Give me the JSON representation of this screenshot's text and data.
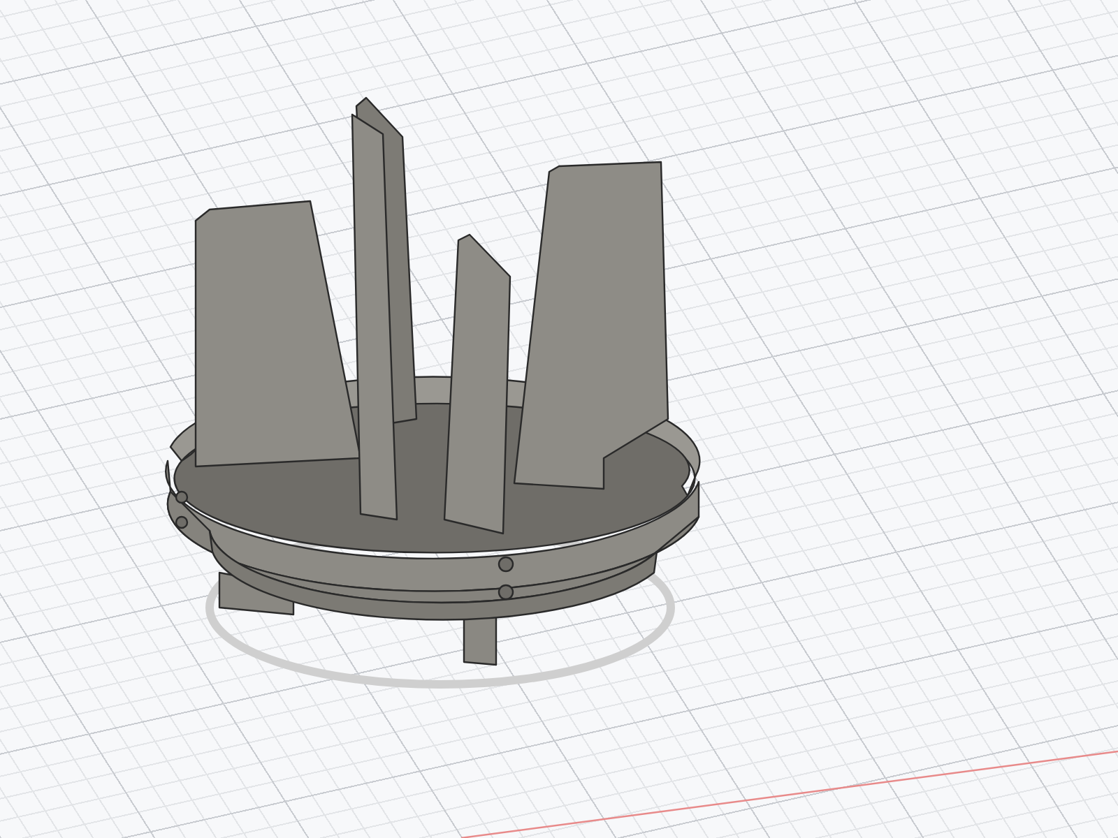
{
  "viewport": {
    "kind": "grid"
  }
}
